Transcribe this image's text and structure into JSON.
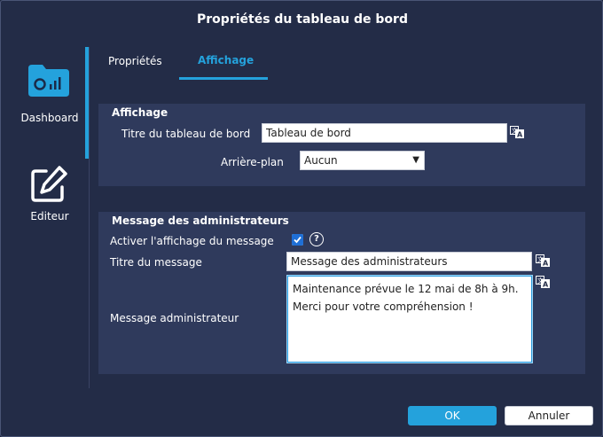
{
  "dialog": {
    "title": "Propriétés du tableau de bord"
  },
  "sidebar": {
    "items": [
      {
        "label": "Dashboard",
        "icon": "dashboard-folder-icon",
        "active": true
      },
      {
        "label": "Editeur",
        "icon": "edit-pencil-icon",
        "active": false
      }
    ]
  },
  "tabs": [
    {
      "label": "Propriétés",
      "active": false
    },
    {
      "label": "Affichage",
      "active": true
    }
  ],
  "display_section": {
    "title": "Affichage",
    "dashboard_title_label": "Titre du tableau de bord",
    "dashboard_title_value": "Tableau de bord",
    "background_label": "Arrière-plan",
    "background_value": "Aucun"
  },
  "admin_section": {
    "title": "Message des administrateurs",
    "enable_label": "Activer l'affichage du message",
    "enable_checked": true,
    "help_glyph": "?",
    "message_title_label": "Titre du message",
    "message_title_value": "Message des administrateurs",
    "message_label": "Message administrateur",
    "message_value": "Maintenance prévue le 12 mai de 8h à 9h.\nMerci pour votre compréhension !"
  },
  "footer": {
    "ok_label": "OK",
    "cancel_label": "Annuler"
  },
  "colors": {
    "accent": "#24a2dc",
    "background": "#232c47",
    "panel": "#2f3a5c"
  }
}
